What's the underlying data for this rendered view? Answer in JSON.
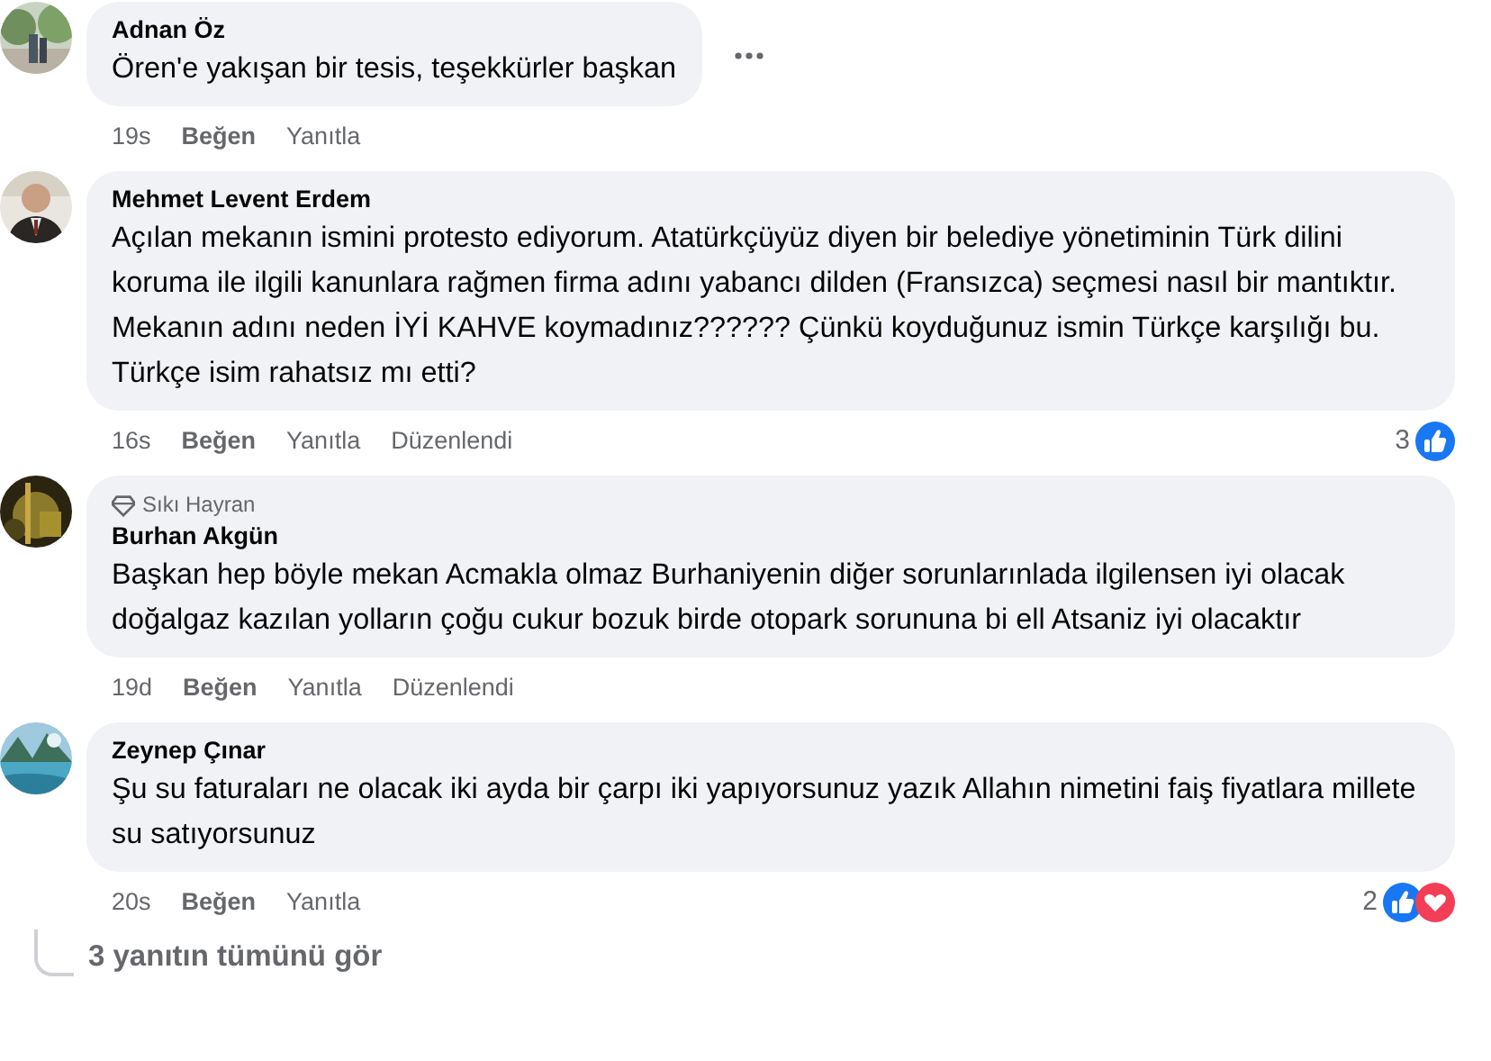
{
  "comments": [
    {
      "author": "Adnan Öz",
      "text": "Ören'e yakışan bir tesis, teşekkürler başkan",
      "menu_visible": true,
      "time": "19s",
      "like": "Beğen",
      "reply": "Yanıtla"
    },
    {
      "author": "Mehmet Levent Erdem",
      "text": "Açılan mekanın ismini protesto ediyorum. Atatürkçüyüz diyen bir belediye yönetiminin Türk dilini koruma ile ilgili kanunlara rağmen firma adını yabancı dilden (Fransızca) seçmesi nasıl bir mantıktır. Mekanın adını neden İYİ KAHVE koymadınız?????? Çünkü koyduğunuz ismin Türkçe karşılığı bu. Türkçe isim rahatsız mı etti?",
      "menu_visible": false,
      "time": "16s",
      "like": "Beğen",
      "reply": "Yanıtla",
      "edited": "Düzenlendi",
      "reactions": {
        "count": "3",
        "like": true,
        "love": false
      }
    },
    {
      "author": "Burhan Akgün",
      "badge": "Sıkı Hayran",
      "text": "Başkan hep böyle mekan Acmakla olmaz Burhaniyenin diğer sorunlarınlada ilgilensen iyi olacak doğalgaz kazılan yolların çoğu cukur bozuk birde otopark sorununa bi ell Atsaniz iyi olacaktır",
      "menu_visible": false,
      "time": "19d",
      "like": "Beğen",
      "reply": "Yanıtla",
      "edited": "Düzenlendi"
    },
    {
      "author": "Zeynep Çınar",
      "text": "Şu su faturaları ne olacak iki ayda bir çarpı iki yapıyorsunuz yazık Allahın nimetini faiş fiyatlara millete su satıyorsunuz",
      "menu_visible": false,
      "time": "20s",
      "like": "Beğen",
      "reply": "Yanıtla",
      "reactions": {
        "count": "2",
        "like": true,
        "love": true
      }
    }
  ],
  "view_replies": "3 yanıtın tümünü gör"
}
